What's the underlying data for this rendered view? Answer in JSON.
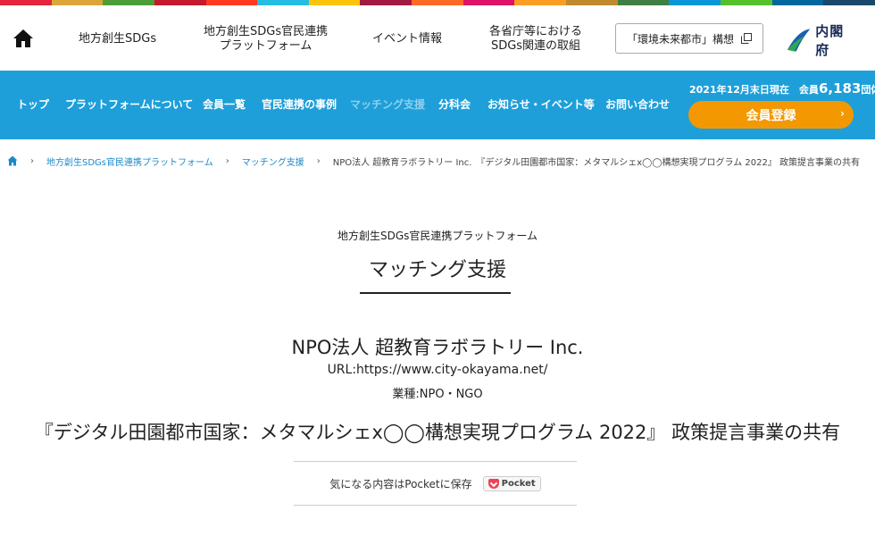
{
  "sdg_colors": [
    "#e5243b",
    "#dda63a",
    "#4c9f38",
    "#c5192d",
    "#ff3a21",
    "#26bde2",
    "#fcc30b",
    "#a21942",
    "#fd6925",
    "#dd1367",
    "#fd9d24",
    "#bf8b2e",
    "#3f7e44",
    "#0a97d9",
    "#56c02b",
    "#00689d",
    "#19486a"
  ],
  "header": {
    "home_icon": "home-icon",
    "nav": [
      {
        "label": "地方創生SDGs"
      },
      {
        "label": "地方創生SDGs官民連携\nプラットフォーム"
      },
      {
        "label": "イベント情報"
      },
      {
        "label": "各省庁等における\nSDGs関連の取組"
      }
    ],
    "kankyo_label": "「環境未来都市」構想",
    "logo_text": "内閣府"
  },
  "main_nav": {
    "items": [
      {
        "label": "トップ"
      },
      {
        "label": "プラットフォームについて"
      },
      {
        "label": "会員一覧"
      },
      {
        "label": "官民連携の事例"
      },
      {
        "label": "マッチング支援"
      },
      {
        "label": "分科会"
      },
      {
        "label": "お知らせ・イベント等"
      },
      {
        "label": "お問い合わせ"
      }
    ],
    "member_prefix": "2021年12月末日現在　会員",
    "member_count": "6,183",
    "member_suffix": "団体",
    "register_label": "会員登録",
    "accent_color": "#1e9fd9",
    "register_color": "#f39800"
  },
  "breadcrumb": {
    "items": [
      "地方創生SDGs官民連携プラットフォーム",
      "マッチング支援"
    ],
    "current": "NPO法人 超教育ラボラトリー Inc.　『デジタル田園都市国家：メタマルシェx◯◯構想実現プログラム 2022』 政策提言事業の共有"
  },
  "page": {
    "section_sub": "地方創生SDGs官民連携プラットフォーム",
    "section_title": "マッチング支援",
    "org_name": "NPO法人 超教育ラボラトリー Inc.",
    "org_url": "URL:https://www.city-okayama.net/",
    "org_industry": "業種:NPO・NGO",
    "article_title": "『デジタル田園都市国家：メタマルシェx◯◯構想実現プログラム 2022』 政策提言事業の共有",
    "pocket_text": "気になる内容はPocketに保存",
    "pocket_label": "Pocket"
  }
}
